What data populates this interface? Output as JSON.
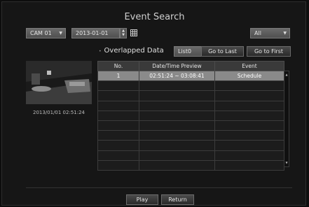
{
  "title": "Event Search",
  "camera": {
    "value": "CAM 01"
  },
  "date": {
    "value": "2013-01-01"
  },
  "filter": {
    "value": "All"
  },
  "overlapped": {
    "label": "Overlapped Data",
    "value": "List0"
  },
  "buttons": {
    "go_last": "Go to Last",
    "go_first": "Go to First",
    "play": "Play",
    "return": "Return"
  },
  "preview": {
    "timestamp": "2013/01/01 02:51:24"
  },
  "table": {
    "headers": {
      "no": "No.",
      "time": "Date/Time Preview",
      "event": "Event"
    },
    "rows": [
      {
        "no": "1",
        "time": "02:51:24 ~ 03:08:41",
        "event": "Schedule",
        "selected": true
      }
    ],
    "empty_rows": 9
  },
  "icons": {
    "dropdown": "chevron-down-icon",
    "calendar": "calendar-icon",
    "spinner": "spinner-icon",
    "scroll_up": "scroll-up-icon",
    "scroll_down": "scroll-down-icon"
  },
  "colors": {
    "selected_row": "#8a8a8a",
    "background": "#161616"
  }
}
